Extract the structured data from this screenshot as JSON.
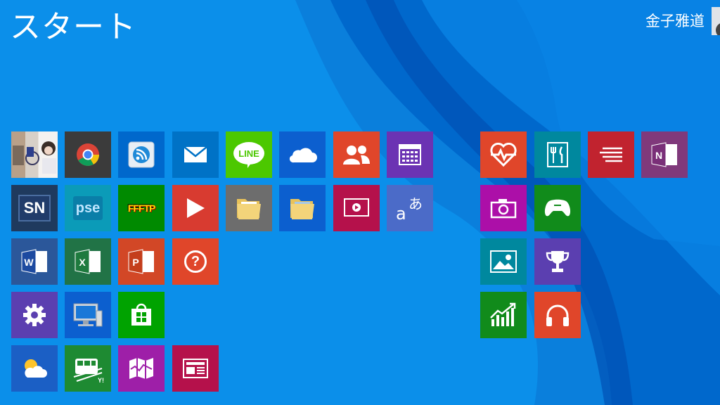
{
  "screen": {
    "title": "スタート"
  },
  "user": {
    "name": "金子雅道"
  },
  "colors": {
    "background": "#0b8fea",
    "accent_dark": "#0052b8"
  },
  "tiles": {
    "chrome": {
      "icon": "chrome-icon"
    },
    "rss": {
      "icon": "rss-reader-icon"
    },
    "mail": {
      "icon": "mail-icon"
    },
    "line": {
      "label": "LINE",
      "icon": "line-icon"
    },
    "onedrive": {
      "icon": "cloud-icon"
    },
    "people": {
      "icon": "people-icon"
    },
    "calendar": {
      "icon": "calendar-icon"
    },
    "sn": {
      "label": "SN"
    },
    "pse": {
      "label": "pse"
    },
    "ffftp": {
      "label": "FFFTP"
    },
    "video": {
      "icon": "play-icon"
    },
    "folder1": {
      "icon": "folder-icon"
    },
    "folder2": {
      "icon": "folder-icon"
    },
    "media": {
      "icon": "media-player-icon"
    },
    "translator": {
      "icon": "translator-icon",
      "glyph1": "あ",
      "glyph2": "a"
    },
    "word": {
      "label": "W"
    },
    "excel": {
      "label": "X"
    },
    "powerpoint": {
      "label": "P"
    },
    "help": {
      "label": "?"
    },
    "settings": {
      "icon": "gear-icon"
    },
    "desktop": {
      "icon": "monitor-icon"
    },
    "store": {
      "icon": "store-icon"
    },
    "weather": {
      "icon": "weather-icon"
    },
    "train": {
      "icon": "train-icon",
      "label": "Y!"
    },
    "maps": {
      "icon": "maps-icon"
    },
    "news": {
      "icon": "news-icon"
    },
    "health": {
      "icon": "heart-icon"
    },
    "food": {
      "icon": "fork-knife-icon"
    },
    "reading": {
      "icon": "reading-list-icon"
    },
    "onenote": {
      "label": "N"
    },
    "camera": {
      "icon": "camera-icon"
    },
    "games": {
      "icon": "xbox-controller-icon"
    },
    "photos": {
      "icon": "photos-icon"
    },
    "sports": {
      "icon": "trophy-icon"
    },
    "finance": {
      "icon": "finance-chart-icon"
    },
    "music": {
      "icon": "headphones-icon"
    }
  }
}
